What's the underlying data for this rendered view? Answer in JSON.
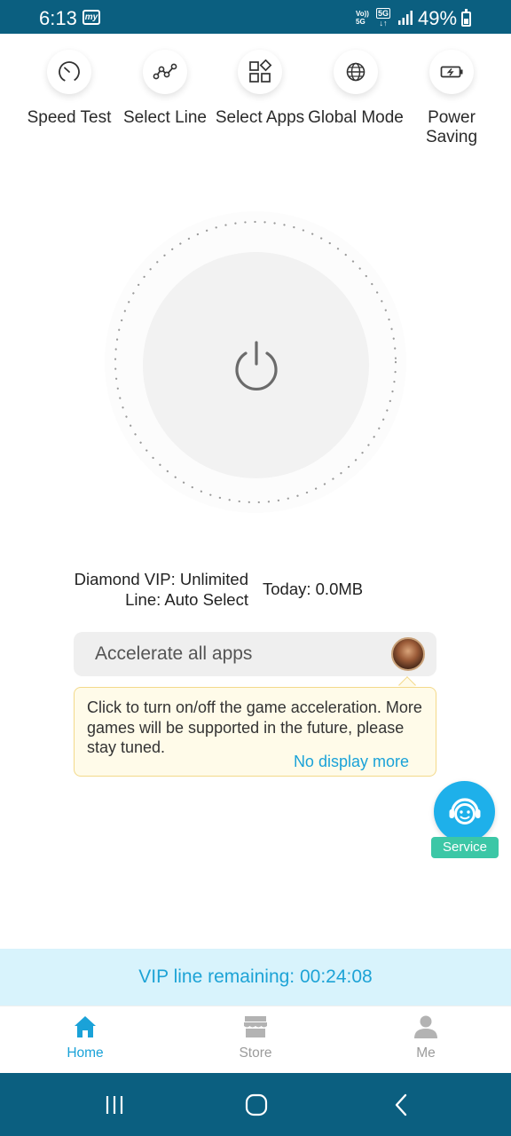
{
  "status_bar": {
    "time": "6:13",
    "app_icon_text": "my",
    "volte": "Vo))",
    "network_volte_sub": "5G",
    "network_type": "5G",
    "battery_percent": "49%"
  },
  "features": [
    {
      "label": "Speed Test",
      "icon": "speedometer-icon"
    },
    {
      "label": "Select Line",
      "icon": "line-nodes-icon"
    },
    {
      "label": "Select Apps",
      "icon": "apps-grid-icon"
    },
    {
      "label": "Global Mode",
      "icon": "globe-icon"
    },
    {
      "label": "Power Saving",
      "icon": "battery-icon"
    }
  ],
  "power": {
    "icon": "power-icon",
    "state": "off"
  },
  "info": {
    "vip": "Diamond VIP: Unlimited",
    "line": "Line: Auto Select",
    "today": "Today: 0.0MB"
  },
  "accelerate": {
    "label": "Accelerate all apps",
    "avatar": "game-avatar"
  },
  "tooltip": {
    "text": "Click to turn on/off the game acceleration. More games will be supported in the future, please stay tuned.",
    "link": "No display more"
  },
  "service": {
    "label": "Service",
    "icon": "headset-face-icon"
  },
  "vip_banner": {
    "text": "VIP line remaining: 00:24:08"
  },
  "bottom_nav": [
    {
      "label": "Home",
      "icon": "home-icon",
      "active": true
    },
    {
      "label": "Store",
      "icon": "store-icon",
      "active": false
    },
    {
      "label": "Me",
      "icon": "person-icon",
      "active": false
    }
  ],
  "colors": {
    "status_bar": "#0b5f80",
    "accent": "#1aa2d8",
    "service_label": "#3cc7a6",
    "banner_bg": "#d8f3fc",
    "tooltip_bg": "#fffbe9",
    "inactive_nav": "#9b9b9b"
  }
}
